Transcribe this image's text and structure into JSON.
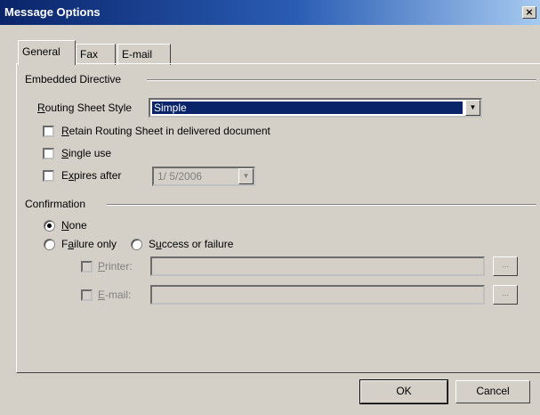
{
  "window": {
    "title": "Message Options",
    "close_glyph": "×"
  },
  "tabs": [
    {
      "label": "General",
      "active": true
    },
    {
      "label": "Fax",
      "active": false
    },
    {
      "label": "E-mail",
      "active": false
    }
  ],
  "embedded": {
    "group_label": "Embedded Directive",
    "routing_label_pre": "R",
    "routing_label_rest": "outing Sheet Style",
    "routing_value": "Simple",
    "retain": {
      "u": "R",
      "rest": "etain Routing Sheet in delivered document",
      "checked": false
    },
    "single_use": {
      "u": "S",
      "rest": "ingle use",
      "checked": false
    },
    "expires": {
      "pre": "E",
      "u": "x",
      "rest": "pires after",
      "checked": false,
      "date": "1/ 5/2006"
    }
  },
  "confirmation": {
    "group_label": "Confirmation",
    "none": {
      "u": "N",
      "rest": "one",
      "selected": true
    },
    "failure_only": {
      "pre": "F",
      "u": "a",
      "rest": "ilure only",
      "selected": false
    },
    "success_or_failure": {
      "pre": "S",
      "u": "u",
      "rest": "ccess or failure",
      "selected": false
    },
    "printer": {
      "u": "P",
      "rest": "rinter:",
      "value": "",
      "browse": "..."
    },
    "email": {
      "u": "E",
      "rest": "-mail:",
      "value": "",
      "browse": "..."
    }
  },
  "buttons": {
    "ok": "OK",
    "cancel": "Cancel"
  },
  "icons": {
    "dropdown": "dropdown-arrow-icon"
  }
}
